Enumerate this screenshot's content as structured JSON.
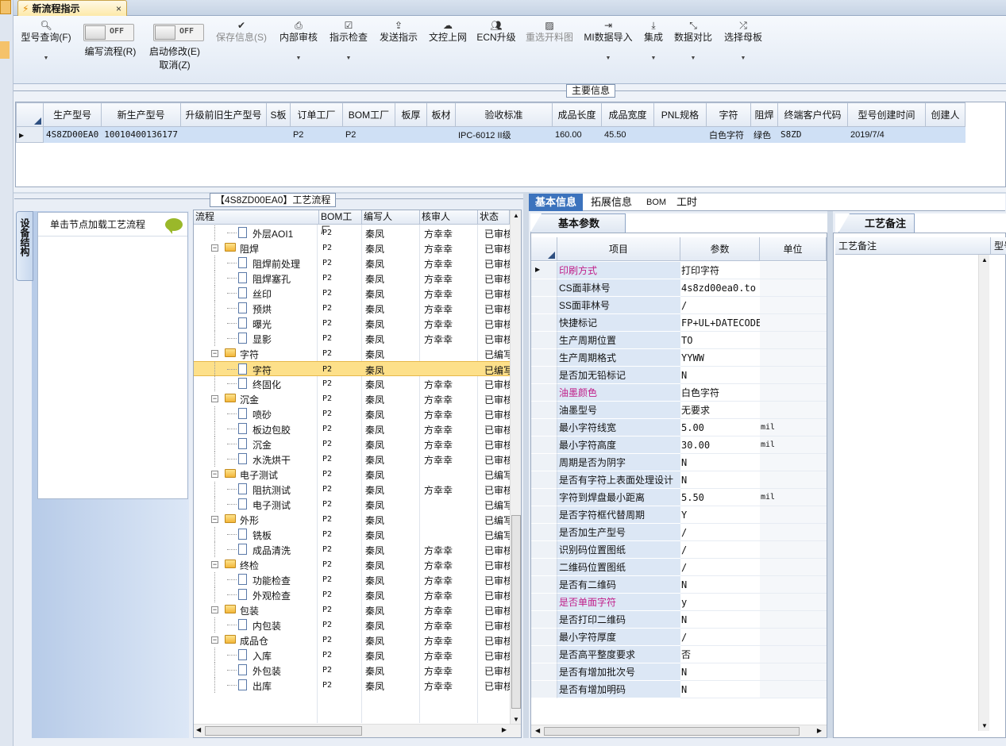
{
  "tab": {
    "title": "新流程指示",
    "close": "×"
  },
  "toolbar": {
    "query": "型号查询(F)",
    "toggle_off": "OFF",
    "write_flow": "编写流程(R)",
    "start_modify": "启动修改(E)",
    "cancel": "取消(Z)",
    "save_info": "保存信息(S)",
    "internal_review": "内部审核",
    "instruction_check": "指示检查",
    "send_instruction": "发送指示",
    "upload_doc": "文控上网",
    "ecn_upgrade": "ECN升级",
    "reselect_drawing": "重选开料图",
    "mi_import": "MI数据导入",
    "integrate": "集成",
    "data_compare": "数据对比",
    "select_master": "选择母板"
  },
  "main_info": {
    "title": "主要信息",
    "columns": [
      "生产型号",
      "新生产型号",
      "升级前旧生产型号",
      "S板",
      "订单工厂",
      "BOM工厂",
      "板厚",
      "板材",
      "验收标准",
      "成品长度",
      "成品宽度",
      "PNL规格",
      "字符",
      "阻焊",
      "终端客户代码",
      "型号创建时间",
      "创建人"
    ],
    "row": [
      "4S8ZD00EA0",
      "10010400136177",
      "",
      "",
      "P2",
      "P2",
      "",
      "",
      "IPC-6012 II级",
      "160.00",
      "45.50",
      "",
      "白色字符",
      "绿色",
      "S8ZD",
      "2019/7/4",
      ""
    ]
  },
  "side": {
    "tab_label": "设备结构",
    "hint": "单击节点加载工艺流程"
  },
  "flow": {
    "title": "【4S8ZD00EA0】工艺流程",
    "columns": [
      "流程",
      "BOM工厂",
      "编写人",
      "核审人",
      "状态"
    ],
    "rows": [
      {
        "name": "外层AOI1",
        "level": 1,
        "folder": false,
        "bom": "P2",
        "writer": "秦凤",
        "reviewer": "方幸幸",
        "status": "已审核"
      },
      {
        "name": "阻焊",
        "level": 0,
        "folder": true,
        "bom": "P2",
        "writer": "秦凤",
        "reviewer": "方幸幸",
        "status": "已审核"
      },
      {
        "name": "阻焊前处理",
        "level": 1,
        "folder": false,
        "bom": "P2",
        "writer": "秦凤",
        "reviewer": "方幸幸",
        "status": "已审核"
      },
      {
        "name": "阻焊塞孔",
        "level": 1,
        "folder": false,
        "bom": "P2",
        "writer": "秦凤",
        "reviewer": "方幸幸",
        "status": "已审核"
      },
      {
        "name": "丝印",
        "level": 1,
        "folder": false,
        "bom": "P2",
        "writer": "秦凤",
        "reviewer": "方幸幸",
        "status": "已审核"
      },
      {
        "name": "预烘",
        "level": 1,
        "folder": false,
        "bom": "P2",
        "writer": "秦凤",
        "reviewer": "方幸幸",
        "status": "已审核"
      },
      {
        "name": "曝光",
        "level": 1,
        "folder": false,
        "bom": "P2",
        "writer": "秦凤",
        "reviewer": "方幸幸",
        "status": "已审核"
      },
      {
        "name": "显影",
        "level": 1,
        "folder": false,
        "bom": "P2",
        "writer": "秦凤",
        "reviewer": "方幸幸",
        "status": "已审核"
      },
      {
        "name": "字符",
        "level": 0,
        "folder": true,
        "bom": "P2",
        "writer": "秦凤",
        "reviewer": "",
        "status": "已编写"
      },
      {
        "name": "字符",
        "level": 1,
        "folder": false,
        "bom": "P2",
        "writer": "秦凤",
        "reviewer": "",
        "status": "已编写",
        "selected": true
      },
      {
        "name": "终固化",
        "level": 1,
        "folder": false,
        "bom": "P2",
        "writer": "秦凤",
        "reviewer": "方幸幸",
        "status": "已审核"
      },
      {
        "name": "沉金",
        "level": 0,
        "folder": true,
        "bom": "P2",
        "writer": "秦凤",
        "reviewer": "方幸幸",
        "status": "已审核"
      },
      {
        "name": "喷砂",
        "level": 1,
        "folder": false,
        "bom": "P2",
        "writer": "秦凤",
        "reviewer": "方幸幸",
        "status": "已审核"
      },
      {
        "name": "板边包胶",
        "level": 1,
        "folder": false,
        "bom": "P2",
        "writer": "秦凤",
        "reviewer": "方幸幸",
        "status": "已审核"
      },
      {
        "name": "沉金",
        "level": 1,
        "folder": false,
        "bom": "P2",
        "writer": "秦凤",
        "reviewer": "方幸幸",
        "status": "已审核"
      },
      {
        "name": "水洗烘干",
        "level": 1,
        "folder": false,
        "bom": "P2",
        "writer": "秦凤",
        "reviewer": "方幸幸",
        "status": "已审核"
      },
      {
        "name": "电子测试",
        "level": 0,
        "folder": true,
        "bom": "P2",
        "writer": "秦凤",
        "reviewer": "",
        "status": "已编写"
      },
      {
        "name": "阻抗测试",
        "level": 1,
        "folder": false,
        "bom": "P2",
        "writer": "秦凤",
        "reviewer": "方幸幸",
        "status": "已审核"
      },
      {
        "name": "电子测试",
        "level": 1,
        "folder": false,
        "bom": "P2",
        "writer": "秦凤",
        "reviewer": "",
        "status": "已编写"
      },
      {
        "name": "外形",
        "level": 0,
        "folder": true,
        "bom": "P2",
        "writer": "秦凤",
        "reviewer": "",
        "status": "已编写"
      },
      {
        "name": "铣板",
        "level": 1,
        "folder": false,
        "bom": "P2",
        "writer": "秦凤",
        "reviewer": "",
        "status": "已编写"
      },
      {
        "name": "成品清洗",
        "level": 1,
        "folder": false,
        "bom": "P2",
        "writer": "秦凤",
        "reviewer": "方幸幸",
        "status": "已审核"
      },
      {
        "name": "终检",
        "level": 0,
        "folder": true,
        "bom": "P2",
        "writer": "秦凤",
        "reviewer": "方幸幸",
        "status": "已审核"
      },
      {
        "name": "功能检查",
        "level": 1,
        "folder": false,
        "bom": "P2",
        "writer": "秦凤",
        "reviewer": "方幸幸",
        "status": "已审核"
      },
      {
        "name": "外观检查",
        "level": 1,
        "folder": false,
        "bom": "P2",
        "writer": "秦凤",
        "reviewer": "方幸幸",
        "status": "已审核"
      },
      {
        "name": "包装",
        "level": 0,
        "folder": true,
        "bom": "P2",
        "writer": "秦凤",
        "reviewer": "方幸幸",
        "status": "已审核"
      },
      {
        "name": "内包装",
        "level": 1,
        "folder": false,
        "bom": "P2",
        "writer": "秦凤",
        "reviewer": "方幸幸",
        "status": "已审核"
      },
      {
        "name": "成品仓",
        "level": 0,
        "folder": true,
        "bom": "P2",
        "writer": "秦凤",
        "reviewer": "方幸幸",
        "status": "已审核"
      },
      {
        "name": "入库",
        "level": 1,
        "folder": false,
        "bom": "P2",
        "writer": "秦凤",
        "reviewer": "方幸幸",
        "status": "已审核"
      },
      {
        "name": "外包装",
        "level": 1,
        "folder": false,
        "bom": "P2",
        "writer": "秦凤",
        "reviewer": "方幸幸",
        "status": "已审核"
      },
      {
        "name": "出库",
        "level": 1,
        "folder": false,
        "bom": "P2",
        "writer": "秦凤",
        "reviewer": "方幸幸",
        "status": "已审核"
      }
    ]
  },
  "right_tabs": [
    "基本信息",
    "拓展信息",
    "BOM",
    "工时"
  ],
  "params": {
    "tab": "基本参数",
    "columns": [
      "项目",
      "参数",
      "单位"
    ],
    "rows": [
      {
        "k": "印刷方式",
        "v": "打印字符",
        "u": "",
        "pink": true
      },
      {
        "k": "CS面菲林号",
        "v": "4s8zd00ea0.to",
        "u": ""
      },
      {
        "k": "SS面菲林号",
        "v": "/",
        "u": ""
      },
      {
        "k": "快捷标记",
        "v": "FP+UL+DATECODE",
        "u": ""
      },
      {
        "k": "生产周期位置",
        "v": "TO",
        "u": ""
      },
      {
        "k": "生产周期格式",
        "v": "YYWW",
        "u": ""
      },
      {
        "k": "是否加无铅标记",
        "v": "N",
        "u": ""
      },
      {
        "k": "油墨颜色",
        "v": "白色字符",
        "u": "",
        "pink": true
      },
      {
        "k": "油墨型号",
        "v": "无要求",
        "u": ""
      },
      {
        "k": "最小字符线宽",
        "v": "5.00",
        "u": "mil"
      },
      {
        "k": "最小字符高度",
        "v": "30.00",
        "u": "mil"
      },
      {
        "k": "周期是否为阴字",
        "v": "N",
        "u": ""
      },
      {
        "k": "是否有字符上表面处理设计",
        "v": "N",
        "u": ""
      },
      {
        "k": "字符到焊盘最小距离",
        "v": "5.50",
        "u": "mil"
      },
      {
        "k": "是否字符框代替周期",
        "v": "Y",
        "u": ""
      },
      {
        "k": "是否加生产型号",
        "v": "/",
        "u": ""
      },
      {
        "k": "识别码位置图纸",
        "v": "/",
        "u": ""
      },
      {
        "k": "二维码位置图纸",
        "v": "/",
        "u": ""
      },
      {
        "k": "是否有二维码",
        "v": "N",
        "u": ""
      },
      {
        "k": "是否单面字符",
        "v": "y",
        "u": "",
        "pink": true
      },
      {
        "k": "是否打印二维码",
        "v": "N",
        "u": ""
      },
      {
        "k": "最小字符厚度",
        "v": "/",
        "u": ""
      },
      {
        "k": "是否高平整度要求",
        "v": "否",
        "u": ""
      },
      {
        "k": "是否有增加批次号",
        "v": "N",
        "u": ""
      },
      {
        "k": "是否有增加明码",
        "v": "N",
        "u": ""
      }
    ]
  },
  "notes": {
    "tab": "工艺备注",
    "col1": "工艺备注",
    "col2": "型号"
  }
}
